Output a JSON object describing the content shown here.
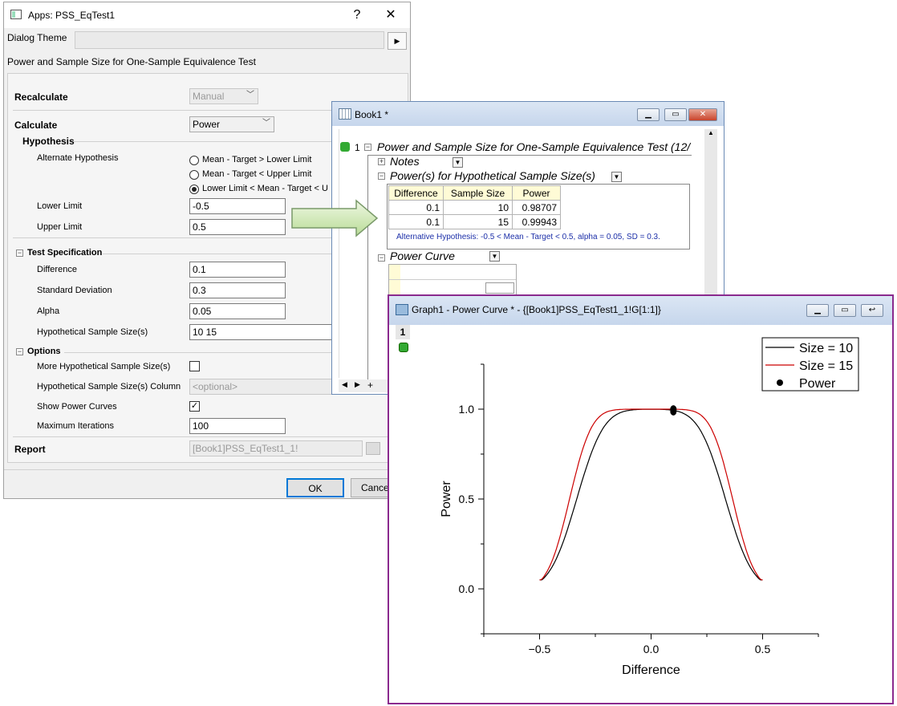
{
  "dialog": {
    "title": "Apps: PSS_EqTest1",
    "help": "?",
    "close": "✕",
    "theme_label": "Dialog Theme",
    "theme_value": "",
    "theme_arrow": "▶",
    "description": "Power and Sample Size for One-Sample Equivalence Test",
    "recalculate_label": "Recalculate",
    "recalculate_value": "Manual",
    "calculate_label": "Calculate",
    "calculate_value": "Power",
    "hypothesis_heading": "Hypothesis",
    "alt_hyp_label": "Alternate Hypothesis",
    "alt_options": [
      "Mean - Target > Lower Limit",
      "Mean - Target < Upper Limit",
      "Lower Limit < Mean - Target < U"
    ],
    "alt_selected": 2,
    "lower_label": "Lower Limit",
    "lower_value": "-0.5",
    "upper_label": "Upper Limit",
    "upper_value": "0.5",
    "test_spec_heading": "Test Specification",
    "difference_label": "Difference",
    "difference_value": "0.1",
    "sd_label": "Standard Deviation",
    "sd_value": "0.3",
    "alpha_label": "Alpha",
    "alpha_value": "0.05",
    "hss_label": "Hypothetical Sample Size(s)",
    "hss_value": "10 15",
    "options_heading": "Options",
    "more_hss_label": "More Hypothetical Sample Size(s)",
    "more_hss_checked": false,
    "hss_column_label": "Hypothetical Sample Size(s) Column",
    "hss_column_placeholder": "<optional>",
    "show_curves_label": "Show Power Curves",
    "show_curves_checked": "✓",
    "max_iter_label": "Maximum Iterations",
    "max_iter_value": "100",
    "report_label": "Report",
    "report_value": "[Book1]PSS_EqTest1_1!",
    "ok_label": "OK",
    "cancel_label": "Cance"
  },
  "book": {
    "title": "Book1 *",
    "row_number": "1",
    "report_title": "Power and Sample Size for One-Sample Equivalence Test (12/",
    "notes_label": "Notes",
    "table_heading": "Power(s) for Hypothetical Sample Size(s)",
    "columns": [
      "Difference",
      "Sample Size",
      "Power"
    ],
    "rows": [
      [
        "0.1",
        "10",
        "0.98707"
      ],
      [
        "0.1",
        "15",
        "0.99943"
      ]
    ],
    "footnote": "Alternative Hypothesis: -0.5 < Mean - Target < 0.5, alpha = 0.05, SD = 0.3.",
    "curve_heading": "Power Curve"
  },
  "graph": {
    "title": "Graph1 - Power Curve * - {[Book1]PSS_EqTest1_1!G[1:1]}",
    "layer": "1"
  },
  "chart_data": {
    "type": "line",
    "xlabel": "Difference",
    "ylabel": "Power",
    "xlim": [
      -0.75,
      0.75
    ],
    "ylim": [
      -0.25,
      1.25
    ],
    "x_ticks": [
      "-0.5",
      "0.0",
      "0.5"
    ],
    "y_ticks": [
      "0.0",
      "0.5",
      "1.0"
    ],
    "legend_position": "top-right",
    "series": [
      {
        "name": "Size = 10",
        "color": "#000000",
        "n": 10,
        "x": [
          -0.5,
          0.5
        ]
      },
      {
        "name": "Size = 15",
        "color": "#cc0000",
        "n": 15,
        "x": [
          -0.5,
          0.5
        ]
      }
    ],
    "points": {
      "name": "Power",
      "color": "#000000",
      "x": [
        0.1,
        0.1
      ],
      "y": [
        0.98707,
        0.99943
      ]
    },
    "sd": 0.3,
    "alpha": 0.05
  }
}
